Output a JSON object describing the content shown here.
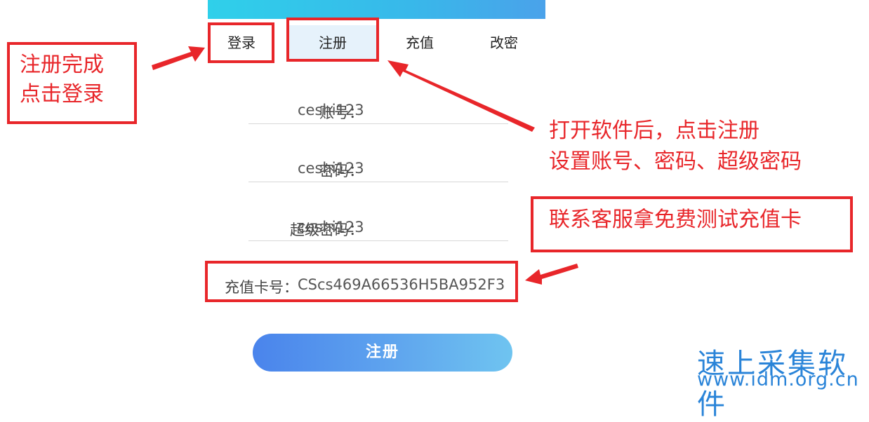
{
  "tabs": {
    "login": "登录",
    "register": "注册",
    "recharge": "充值",
    "change_password": "改密"
  },
  "form": {
    "account": {
      "label": "账号：",
      "value": "ceshi123"
    },
    "password": {
      "label": "密码：",
      "value": "ceshi123"
    },
    "super_password": {
      "label": "超级密码：",
      "value": "ceshi123"
    },
    "card_number": {
      "label": "充值卡号：",
      "value": "CScs469A66536H5BA952F3"
    }
  },
  "submit_label": "注册",
  "annotations": {
    "after_register": [
      "注册完成",
      "点击登录"
    ],
    "open_software": [
      "打开软件后，点击注册",
      "设置账号、密码、超级密码"
    ],
    "contact_service": "联系客服拿免费测试充值卡"
  },
  "watermark": {
    "name": "速上采集软件",
    "url": "www.idm.org.cn"
  },
  "colors": {
    "annotation_red": "#e8262a",
    "watermark_blue": "#2a84d8",
    "tab_active_bg": "#e6f2fb"
  }
}
